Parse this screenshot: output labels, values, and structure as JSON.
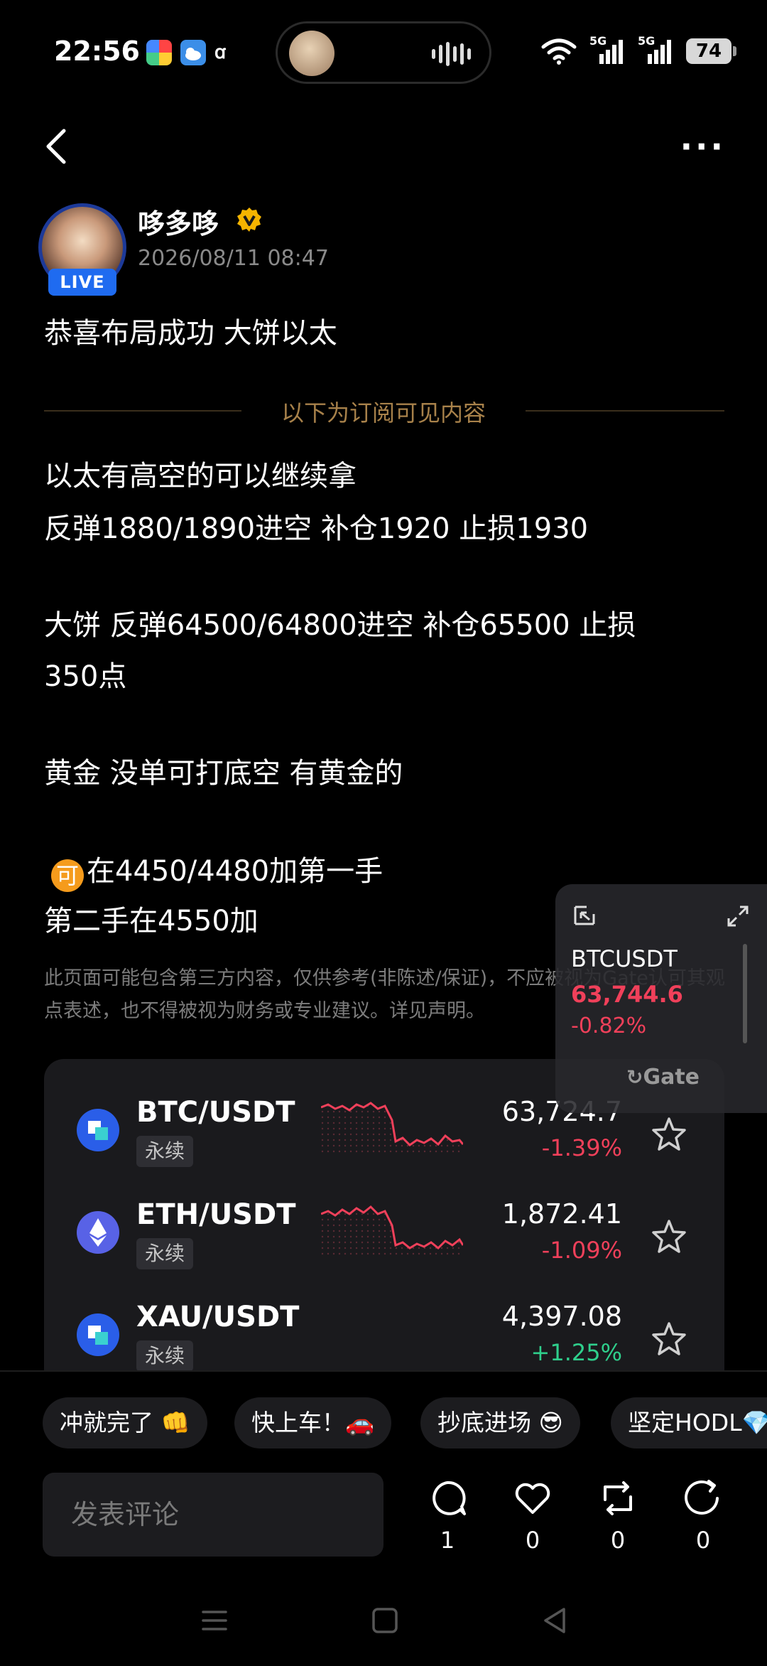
{
  "status_bar": {
    "time": "22:56",
    "network_1": "5G",
    "network_2": "5G",
    "battery": "74"
  },
  "author": {
    "name": "哆多哆",
    "live_badge": "LIVE",
    "date": "2026/08/11 08:47"
  },
  "post": {
    "title": "恭喜布局成功 大饼以太",
    "subscriber_divider": "以下为订阅可见内容",
    "lines": [
      "以太有高空的可以继续拿",
      "反弹1880/1890进空  补仓1920  止损1930",
      "大饼 反弹64500/64800进空  补仓65500  止损",
      "350点",
      "黄金 没单可打底空  有黄金的",
      "在4450/4480加第一手",
      "第二手在4550加"
    ],
    "emoji_char": "可",
    "disclaimer": "此页面可能包含第三方内容，仅供参考(非陈述/保证)，不应被视为Gate认可其观点表述，也不得被视为财务或专业建议。详见声明。"
  },
  "markets": [
    {
      "pair": "BTC/USDT",
      "tag": "永续",
      "price": "63,724.7",
      "change": "-1.39%",
      "direction": "down"
    },
    {
      "pair": "ETH/USDT",
      "tag": "永续",
      "price": "1,872.41",
      "change": "-1.09%",
      "direction": "down"
    },
    {
      "pair": "XAU/USDT",
      "tag": "永续",
      "price": "4,397.08",
      "change": "+1.25%",
      "direction": "up"
    }
  ],
  "float_widget": {
    "symbol": "BTCUSDT",
    "price": "63,744.6",
    "change": "-0.82%",
    "brand": "Gate"
  },
  "quick_chips": [
    "冲就完了 👊",
    "快上车！🚗",
    "抄底进场 😎",
    "坚定HODL💎"
  ],
  "comment": {
    "placeholder": "发表评论"
  },
  "actions": {
    "comments": "1",
    "likes": "0",
    "reposts": "0",
    "shares": "0"
  },
  "colors": {
    "negative": "#f0405a",
    "positive": "#2fcf8c",
    "accent": "#1f6bf0",
    "divider_gold": "#a7814a"
  }
}
